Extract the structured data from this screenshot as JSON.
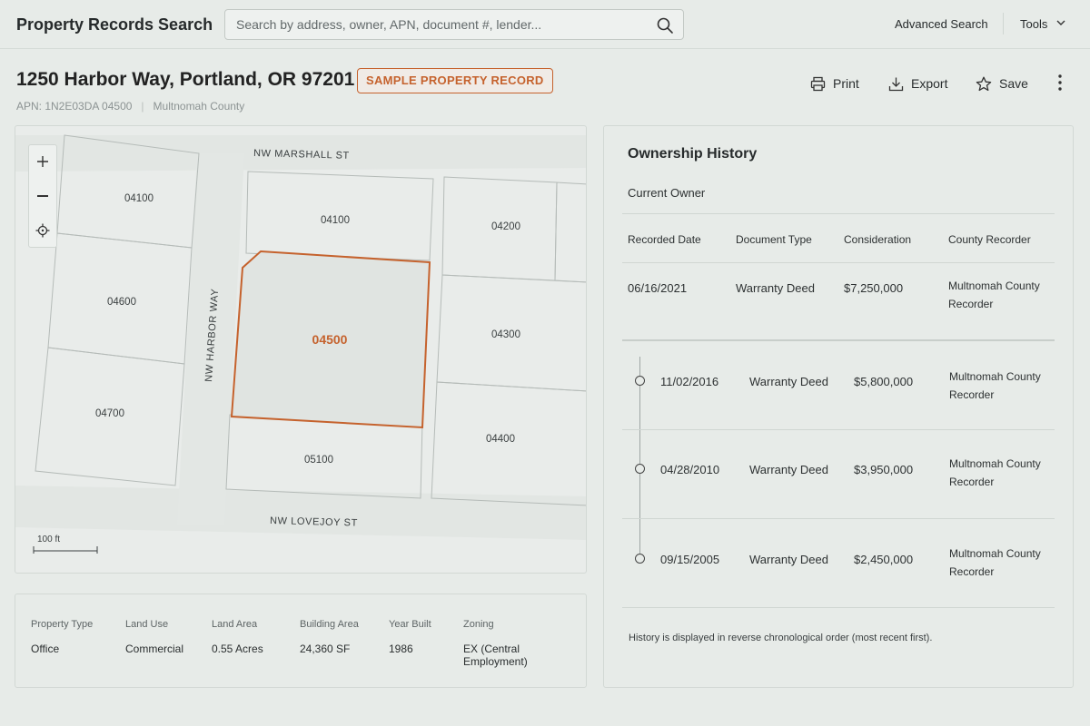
{
  "header": {
    "app_title": "Property Records Search",
    "search_placeholder": "Search by address, owner, APN, document #, lender...",
    "advanced_search": "Advanced Search",
    "tools": "Tools"
  },
  "record": {
    "address": "1250 Harbor Way, Portland, OR 97201",
    "badge": "SAMPLE PROPERTY RECORD",
    "apn": "APN: 1N2E03DA 04500",
    "county": "Multnomah County"
  },
  "actions": {
    "print": "Print",
    "export": "Export",
    "save": "Save"
  },
  "map": {
    "streets": {
      "north": "NW MARSHALL ST",
      "west": "NW HARBOR WAY",
      "south": "NW LOVEJOY ST"
    },
    "parcels": {
      "nw_top": "04100",
      "center_top": "04100",
      "ne_top": "04200",
      "w_mid": "04600",
      "selected": "04500",
      "e_mid": "04300",
      "sw": "04700",
      "s_center": "05100",
      "se": "04400"
    },
    "scale": "100 ft",
    "controls": [
      "zoom-in",
      "zoom-out",
      "locate"
    ],
    "colors": {
      "selected_outline": "#c5622d"
    }
  },
  "details": {
    "columns": [
      {
        "label": "Property Type",
        "value": "Office"
      },
      {
        "label": "Land Use",
        "value": "Commercial"
      },
      {
        "label": "Land Area",
        "value": "0.55 Acres"
      },
      {
        "label": "Building Area",
        "value": "24,360 SF"
      },
      {
        "label": "Year Built",
        "value": "1986"
      },
      {
        "label": "Zoning",
        "value": "EX (Central Employment)"
      }
    ]
  },
  "history": {
    "title": "Ownership History",
    "current_owner_label": "Current Owner",
    "headers": {
      "date": "Recorded Date",
      "doc_type": "Document Type",
      "consideration": "Consideration",
      "recorder": "County Recorder"
    },
    "current": {
      "date": "06/16/2021",
      "doc_type": "Warranty Deed",
      "consideration": "$7,250,000",
      "recorder_line1": "Multnomah County",
      "recorder_line2": "Recorder"
    },
    "previous": [
      {
        "date": "11/02/2016",
        "doc_type": "Warranty Deed",
        "consideration": "$5,800,000",
        "recorder_line1": "Multnomah County",
        "recorder_line2": "Recorder"
      },
      {
        "date": "04/28/2010",
        "doc_type": "Warranty Deed",
        "consideration": "$3,950,000",
        "recorder_line1": "Multnomah County",
        "recorder_line2": "Recorder"
      },
      {
        "date": "09/15/2005",
        "doc_type": "Warranty Deed",
        "consideration": "$2,450,000",
        "recorder_line1": "Multnomah County",
        "recorder_line2": "Recorder"
      }
    ],
    "note": "History is displayed in reverse chronological order (most recent first)."
  }
}
